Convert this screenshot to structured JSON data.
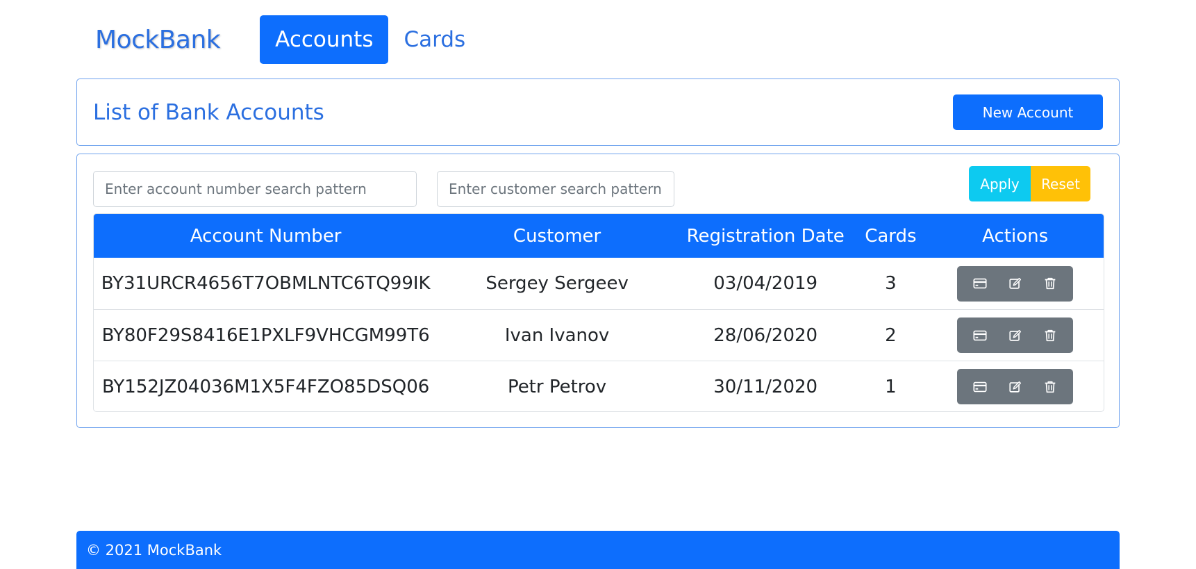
{
  "app": {
    "brand": "MockBank"
  },
  "nav": {
    "items": [
      {
        "label": "Accounts",
        "active": true
      },
      {
        "label": "Cards",
        "active": false
      }
    ]
  },
  "header": {
    "title": "List of Bank Accounts",
    "new_account_label": "New Account"
  },
  "filters": {
    "account_placeholder": "Enter account number search pattern",
    "customer_placeholder": "Enter customer search pattern",
    "apply_label": "Apply",
    "reset_label": "Reset"
  },
  "table": {
    "columns": [
      "Account Number",
      "Customer",
      "Registration Date",
      "Cards",
      "Actions"
    ],
    "rows": [
      {
        "account": "BY31URCR4656T7OBMLNTC6TQ99IK",
        "customer": "Sergey Sergeev",
        "date": "03/04/2019",
        "cards": "3"
      },
      {
        "account": "BY80F29S8416E1PXLF9VHCGM99T6",
        "customer": "Ivan Ivanov",
        "date": "28/06/2020",
        "cards": "2"
      },
      {
        "account": "BY152JZ04036M1X5F4FZO85DSQ06",
        "customer": "Petr Petrov",
        "date": "30/11/2020",
        "cards": "1"
      }
    ],
    "row_actions": [
      "credit-card-icon",
      "edit-icon",
      "trash-icon"
    ]
  },
  "footer": {
    "text": "© 2021 MockBank"
  },
  "colors": {
    "primary": "#0d6efd",
    "info": "#0dcaf0",
    "warning": "#ffc107",
    "secondary": "#6c757d",
    "border": "#6ea2ee"
  }
}
